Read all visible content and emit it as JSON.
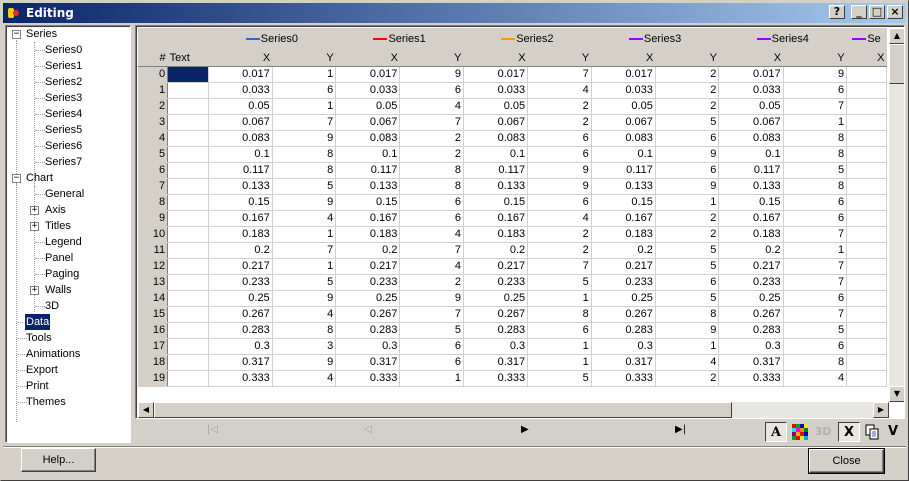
{
  "window": {
    "title": "Editing",
    "buttons": {
      "help": "?",
      "minimize": "_",
      "maximize": "□",
      "close": "×"
    }
  },
  "tree": {
    "root_series": "Series",
    "series": [
      "Series0",
      "Series1",
      "Series2",
      "Series3",
      "Series4",
      "Series5",
      "Series6",
      "Series7"
    ],
    "root_chart": "Chart",
    "chart_items": [
      "General",
      "Axis",
      "Titles",
      "Legend",
      "Panel",
      "Paging",
      "Walls",
      "3D"
    ],
    "top_items": [
      "Data",
      "Tools",
      "Animations",
      "Export",
      "Print",
      "Themes"
    ],
    "selected": "Data"
  },
  "grid": {
    "row_header": "#",
    "text_header": "Text",
    "x_header": "X",
    "y_header": "Y",
    "series": [
      {
        "name": "Series0",
        "color": "#3366cc"
      },
      {
        "name": "Series1",
        "color": "#ff0000"
      },
      {
        "name": "Series2",
        "color": "#ff9900"
      },
      {
        "name": "Series3",
        "color": "#9900ff"
      },
      {
        "name": "Series4",
        "color": "#9900ff"
      },
      {
        "name": "Se",
        "color": "#9900ff"
      }
    ],
    "rows": [
      {
        "idx": "0",
        "cells": [
          "0.017",
          "1",
          "0.017",
          "9",
          "0.017",
          "7",
          "0.017",
          "2",
          "0.017",
          "9"
        ]
      },
      {
        "idx": "1",
        "cells": [
          "0.033",
          "6",
          "0.033",
          "6",
          "0.033",
          "4",
          "0.033",
          "2",
          "0.033",
          "6"
        ]
      },
      {
        "idx": "2",
        "cells": [
          "0.05",
          "1",
          "0.05",
          "4",
          "0.05",
          "2",
          "0.05",
          "2",
          "0.05",
          "7"
        ]
      },
      {
        "idx": "3",
        "cells": [
          "0.067",
          "7",
          "0.067",
          "7",
          "0.067",
          "2",
          "0.067",
          "5",
          "0.067",
          "1"
        ]
      },
      {
        "idx": "4",
        "cells": [
          "0.083",
          "9",
          "0.083",
          "2",
          "0.083",
          "6",
          "0.083",
          "6",
          "0.083",
          "8"
        ]
      },
      {
        "idx": "5",
        "cells": [
          "0.1",
          "8",
          "0.1",
          "2",
          "0.1",
          "6",
          "0.1",
          "9",
          "0.1",
          "8"
        ]
      },
      {
        "idx": "6",
        "cells": [
          "0.117",
          "8",
          "0.117",
          "8",
          "0.117",
          "9",
          "0.117",
          "6",
          "0.117",
          "5"
        ]
      },
      {
        "idx": "7",
        "cells": [
          "0.133",
          "5",
          "0.133",
          "8",
          "0.133",
          "9",
          "0.133",
          "9",
          "0.133",
          "8"
        ]
      },
      {
        "idx": "8",
        "cells": [
          "0.15",
          "9",
          "0.15",
          "6",
          "0.15",
          "6",
          "0.15",
          "1",
          "0.15",
          "6"
        ]
      },
      {
        "idx": "9",
        "cells": [
          "0.167",
          "4",
          "0.167",
          "6",
          "0.167",
          "4",
          "0.167",
          "2",
          "0.167",
          "6"
        ]
      },
      {
        "idx": "10",
        "cells": [
          "0.183",
          "1",
          "0.183",
          "4",
          "0.183",
          "2",
          "0.183",
          "2",
          "0.183",
          "7"
        ]
      },
      {
        "idx": "11",
        "cells": [
          "0.2",
          "7",
          "0.2",
          "7",
          "0.2",
          "2",
          "0.2",
          "5",
          "0.2",
          "1"
        ]
      },
      {
        "idx": "12",
        "cells": [
          "0.217",
          "1",
          "0.217",
          "4",
          "0.217",
          "7",
          "0.217",
          "5",
          "0.217",
          "7"
        ]
      },
      {
        "idx": "13",
        "cells": [
          "0.233",
          "5",
          "0.233",
          "2",
          "0.233",
          "5",
          "0.233",
          "6",
          "0.233",
          "7"
        ]
      },
      {
        "idx": "14",
        "cells": [
          "0.25",
          "9",
          "0.25",
          "9",
          "0.25",
          "1",
          "0.25",
          "5",
          "0.25",
          "6"
        ]
      },
      {
        "idx": "15",
        "cells": [
          "0.267",
          "4",
          "0.267",
          "7",
          "0.267",
          "8",
          "0.267",
          "8",
          "0.267",
          "7"
        ]
      },
      {
        "idx": "16",
        "cells": [
          "0.283",
          "8",
          "0.283",
          "5",
          "0.283",
          "6",
          "0.283",
          "9",
          "0.283",
          "5"
        ]
      },
      {
        "idx": "17",
        "cells": [
          "0.3",
          "3",
          "0.3",
          "6",
          "0.3",
          "1",
          "0.3",
          "1",
          "0.3",
          "6"
        ]
      },
      {
        "idx": "18",
        "cells": [
          "0.317",
          "9",
          "0.317",
          "6",
          "0.317",
          "1",
          "0.317",
          "4",
          "0.317",
          "8"
        ]
      },
      {
        "idx": "19",
        "cells": [
          "0.333",
          "4",
          "0.333",
          "1",
          "0.333",
          "5",
          "0.333",
          "2",
          "0.333",
          "4"
        ]
      }
    ]
  },
  "navigator": {
    "first": "|◁",
    "prev": "◁",
    "next": "▶",
    "last": "▶|"
  },
  "toolbar": {
    "font_label": "A",
    "three_d_label": "3D",
    "delete_label": "X",
    "v_label": "V"
  },
  "footer": {
    "help_label": "Help...",
    "close_label": "Close"
  }
}
